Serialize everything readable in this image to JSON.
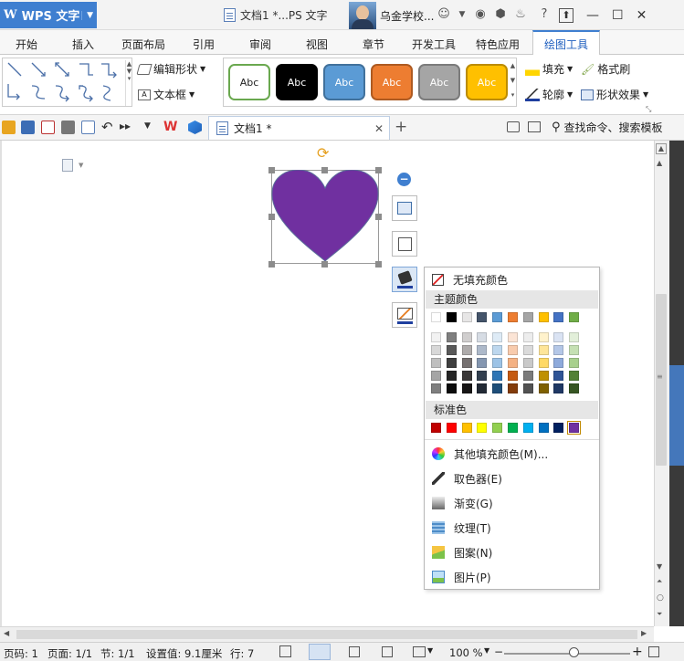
{
  "app": {
    "name": "WPS 文字",
    "logo": "W"
  },
  "titlebar": {
    "doc_title": "文档1 *...PS 文字",
    "user": "乌金学校...",
    "window_controls": [
      "⬆",
      "—",
      "☐",
      "✕"
    ]
  },
  "menu": {
    "tabs": [
      "开始",
      "插入",
      "页面布局",
      "引用",
      "审阅",
      "视图",
      "章节",
      "开发工具",
      "特色应用",
      "绘图工具"
    ],
    "active": "绘图工具"
  },
  "ribbon": {
    "edit_shape": "编辑形状",
    "text_box": "文本框",
    "fill": "填充",
    "format_painter": "格式刷",
    "outline": "轮廓",
    "shape_effects": "形状效果",
    "styles": [
      {
        "label": "Abc",
        "bg": "#ffffff",
        "fg": "#222222",
        "border": "#6aa84f"
      },
      {
        "label": "Abc",
        "bg": "#000000",
        "fg": "#ffffff",
        "border": "#000000"
      },
      {
        "label": "Abc",
        "bg": "#5b9bd5",
        "fg": "#ffffff",
        "border": "#41719c"
      },
      {
        "label": "Abc",
        "bg": "#ed7d31",
        "fg": "#ffffff",
        "border": "#ae5a21"
      },
      {
        "label": "Abc",
        "bg": "#a5a5a5",
        "fg": "#ffffff",
        "border": "#7b7b7b"
      },
      {
        "label": "Abc",
        "bg": "#ffc000",
        "fg": "#ffffff",
        "border": "#bc8c00"
      }
    ]
  },
  "quickbar": {
    "doc_tab": "文档1 *",
    "search": "查找命令、搜索模板"
  },
  "shape": {
    "fill": "#7030a0",
    "outline": "#5a6f9a"
  },
  "fill_menu": {
    "no_fill": "无填充颜色",
    "theme_colors_label": "主题颜色",
    "theme_row": [
      "#ffffff",
      "#000000",
      "#e7e6e6",
      "#44546a",
      "#5b9bd5",
      "#ed7d31",
      "#a5a5a5",
      "#ffc000",
      "#4472c4",
      "#70ad47"
    ],
    "shades": [
      [
        "#f2f2f2",
        "#7f7f7f",
        "#d0cece",
        "#d6dce4",
        "#deebf6",
        "#fbe4d5",
        "#ededed",
        "#fff2cc",
        "#dae3f3",
        "#e2efd9"
      ],
      [
        "#d8d8d8",
        "#595959",
        "#aeabab",
        "#adb9ca",
        "#bdd7ee",
        "#f8cbad",
        "#dbdbdb",
        "#fee599",
        "#b4c7e7",
        "#c5e0b3"
      ],
      [
        "#bfbfbf",
        "#3f3f3f",
        "#757070",
        "#8496b0",
        "#9dc3e6",
        "#f4b183",
        "#c9c9c9",
        "#ffd965",
        "#8eaadb",
        "#a8d08d"
      ],
      [
        "#a5a5a5",
        "#262626",
        "#3a3838",
        "#323f4f",
        "#2e75b5",
        "#c55a11",
        "#7b7b7b",
        "#bf9000",
        "#2f5496",
        "#538135"
      ],
      [
        "#7f7f7f",
        "#0c0c0c",
        "#171616",
        "#222a35",
        "#1e4e79",
        "#833c0b",
        "#525252",
        "#7f6000",
        "#1f3864",
        "#375623"
      ]
    ],
    "standard_label": "标准色",
    "standard": [
      "#c00000",
      "#ff0000",
      "#ffc000",
      "#ffff00",
      "#92d050",
      "#00b050",
      "#00b0f0",
      "#0070c0",
      "#002060",
      "#7030a0"
    ],
    "more_colors": "其他填充颜色(M)...",
    "eyedropper": "取色器(E)",
    "gradient": "渐变(G)",
    "texture": "纹理(T)",
    "pattern": "图案(N)",
    "picture": "图片(P)"
  },
  "status": {
    "page_code": "页码: 1",
    "page": "页面: 1/1",
    "section": "节: 1/1",
    "set_value": "设置值: 9.1厘米",
    "line": "行: 7",
    "zoom": "100 %",
    "zoom_level": 0.55
  }
}
